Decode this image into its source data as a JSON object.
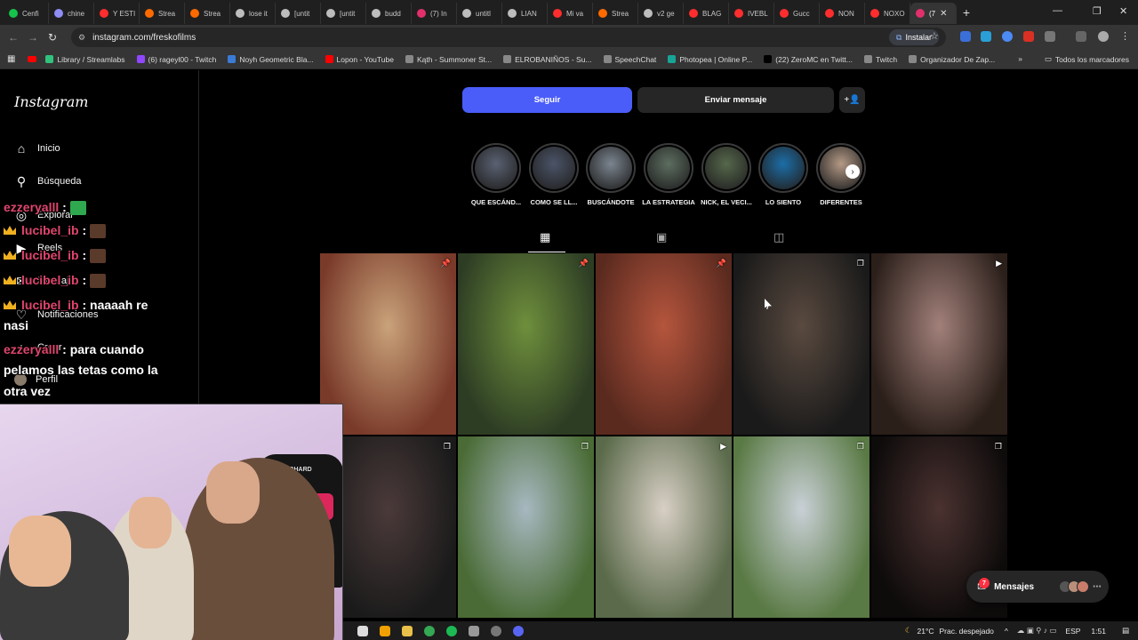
{
  "browser": {
    "tabs": [
      {
        "label": "Cenfi",
        "color": "#15c24a"
      },
      {
        "label": "chine",
        "color": "#8e8ef5"
      },
      {
        "label": "Y ESTI",
        "color": "#ff2d2d"
      },
      {
        "label": "Strea",
        "color": "#ff6a00"
      },
      {
        "label": "Strea",
        "color": "#ff6a00"
      },
      {
        "label": "lose it",
        "color": "#bdbdbd"
      },
      {
        "label": "[untit",
        "color": "#bdbdbd"
      },
      {
        "label": "[untit",
        "color": "#bdbdbd"
      },
      {
        "label": "budd",
        "color": "#bdbdbd"
      },
      {
        "label": "(7) In",
        "color": "#e1306c"
      },
      {
        "label": "untitl",
        "color": "#bdbdbd"
      },
      {
        "label": "LIAN",
        "color": "#bdbdbd"
      },
      {
        "label": "Mi va",
        "color": "#ff2d2d"
      },
      {
        "label": "Strea",
        "color": "#ff6a00"
      },
      {
        "label": "v2 ge",
        "color": "#bdbdbd"
      },
      {
        "label": "BLAG",
        "color": "#ff2d2d"
      },
      {
        "label": "IVEBL",
        "color": "#ff2d2d"
      },
      {
        "label": "Gucc",
        "color": "#ff2d2d"
      },
      {
        "label": "NON",
        "color": "#ff2d2d"
      },
      {
        "label": "NOXO",
        "color": "#ff2d2d"
      },
      {
        "label": "(7",
        "color": "#e1306c",
        "active": true
      }
    ],
    "new_tab": "+",
    "url": "instagram.com/freskofilms",
    "install_label": "Instalar",
    "bookmarks": [
      {
        "label": "Library / Streamlabs",
        "color": "#31c27c"
      },
      {
        "label": "(6) rageyl00 - Twitch",
        "color": "#9146ff"
      },
      {
        "label": "Noyh Geometric Bla...",
        "color": "#3a7bd5"
      },
      {
        "label": "Lopon - YouTube",
        "color": "#ff0000"
      },
      {
        "label": "Kąth - Summoner St...",
        "color": "#888888"
      },
      {
        "label": "ELROBANIÑOS - Su...",
        "color": "#888888"
      },
      {
        "label": "SpeechChat",
        "color": "#888888"
      },
      {
        "label": "Photopea | Online P...",
        "color": "#18a497"
      },
      {
        "label": "(22) ZeroMC en Twitt...",
        "color": "#000000"
      },
      {
        "label": "Twitch",
        "color": "#888888"
      },
      {
        "label": "Organizador De Zap...",
        "color": "#888888"
      }
    ],
    "all_bookmarks": "Todos los marcadores"
  },
  "instagram": {
    "logo": "Instagram",
    "nav": [
      {
        "label": "Inicio",
        "icon": "home-icon",
        "glyph": "⌂"
      },
      {
        "label": "Búsqueda",
        "icon": "search-icon",
        "glyph": "⚲"
      },
      {
        "label": "Explorar",
        "icon": "compass-icon",
        "glyph": "◎"
      },
      {
        "label": "Reels",
        "icon": "reels-icon",
        "glyph": "▶"
      },
      {
        "label": "Mensajes",
        "icon": "messenger-icon",
        "glyph": "✉"
      },
      {
        "label": "Notificaciones",
        "icon": "heart-icon",
        "glyph": "♡"
      },
      {
        "label": "Crear",
        "icon": "plus-icon",
        "glyph": "+"
      },
      {
        "label": "Perfil",
        "icon": "profile-avatar",
        "glyph": "●"
      }
    ],
    "follow_label": "Seguir",
    "message_label": "Enviar mensaje",
    "highlights": [
      {
        "label": "QUE ESCÁND...",
        "color": "#5a6172"
      },
      {
        "label": "COMO SE LL...",
        "color": "#4b5468"
      },
      {
        "label": "BUSCÁNDOTE",
        "color": "#7b8590"
      },
      {
        "label": "LA ESTRATEGIA",
        "color": "#5d6e60"
      },
      {
        "label": "NICK, EL VECI...",
        "color": "#56684b"
      },
      {
        "label": "LO SIENTO",
        "color": "#1c6ea8"
      },
      {
        "label": "DIFERENTES",
        "color": "#b59a86"
      }
    ],
    "posts": [
      {
        "colors": [
          "#7a3a2a",
          "#c9a27a"
        ],
        "badge": "📌"
      },
      {
        "colors": [
          "#2d3d24",
          "#6f8f3c"
        ],
        "badge": "📌"
      },
      {
        "colors": [
          "#5a2a1f",
          "#b5553d"
        ],
        "badge": "📌"
      },
      {
        "colors": [
          "#1a1a1a",
          "#5a4a40"
        ],
        "badge": "❐"
      },
      {
        "colors": [
          "#2b1f1a",
          "#a2807a"
        ],
        "badge": "▶"
      },
      {
        "colors": [
          "#1a1a1a",
          "#4b3a3a"
        ],
        "badge": "❐"
      },
      {
        "colors": [
          "#4a6b35",
          "#a7b8c0"
        ],
        "badge": "❐"
      },
      {
        "colors": [
          "#5a6a4a",
          "#d8cfc5"
        ],
        "badge": "▶"
      },
      {
        "colors": [
          "#5a7a45",
          "#c9d0d6"
        ],
        "badge": "❐"
      },
      {
        "colors": [
          "#0e0b0b",
          "#4a3230"
        ],
        "badge": "❐"
      }
    ],
    "messages_label": "Mensajes",
    "messages_count": "7"
  },
  "chat": [
    {
      "user": "ezzeryalll",
      "text": ":",
      "crown": false,
      "emote": "green"
    },
    {
      "user": "lucibel_ib",
      "text": ":",
      "crown": true,
      "emote": "brown"
    },
    {
      "user": "lucibel_ib",
      "text": ":",
      "crown": true,
      "emote": "brown"
    },
    {
      "user": "lucibel_ib",
      "text": ":",
      "crown": true,
      "emote": "brown"
    },
    {
      "user": "lucibel_ib",
      "text": ": naaaah re",
      "crown": true,
      "emote": ""
    },
    {
      "user": "",
      "text": "nasi",
      "crown": false,
      "emote": ""
    },
    {
      "user": "ezzeryalll",
      "text": ": para cuando",
      "crown": false,
      "emote": ""
    },
    {
      "user": "",
      "text": "pelamos las tetas como la",
      "crown": false,
      "emote": ""
    },
    {
      "user": "",
      "text": "otra vez",
      "crown": false,
      "emote": ""
    }
  ],
  "webcam": {
    "chair_brand": "NOHARD"
  },
  "taskbar": {
    "temperature": "21°C",
    "weather": "Prac. despejado",
    "language": "ESP",
    "time": "1:51"
  }
}
